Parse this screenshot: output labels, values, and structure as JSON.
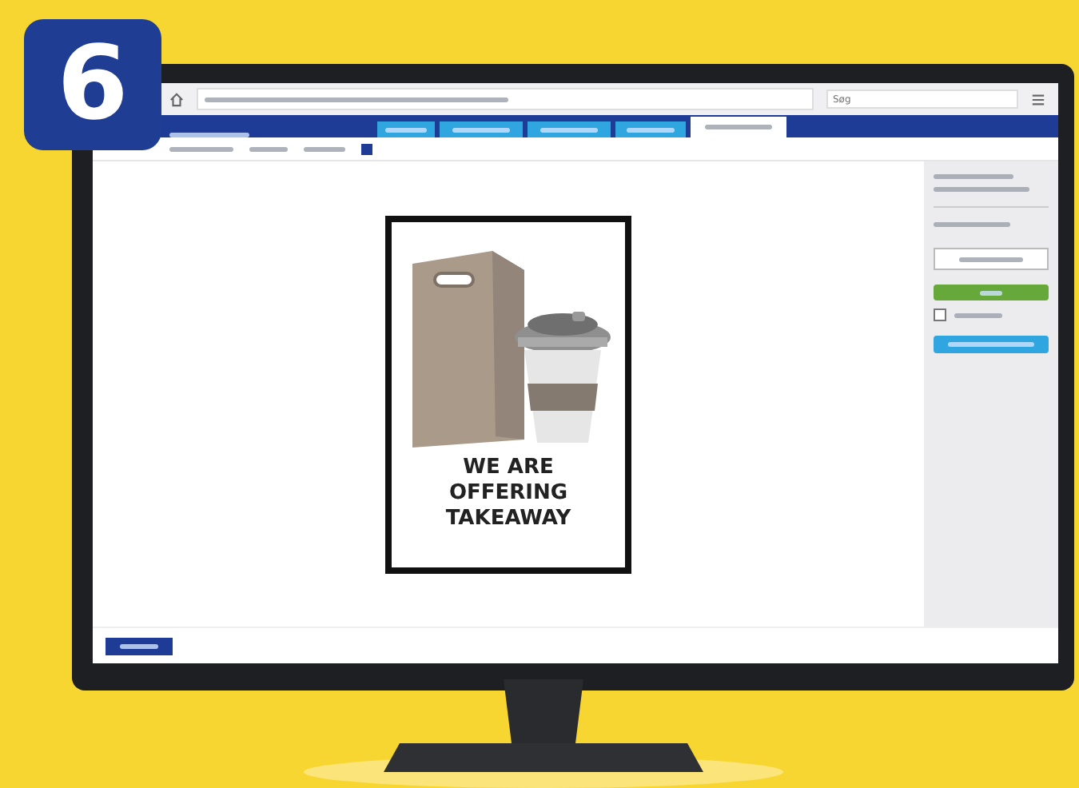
{
  "step_badge": "6",
  "browser": {
    "search": {
      "placeholder": "Søg"
    }
  },
  "nav": {
    "tabs": [
      {
        "selected": false
      },
      {
        "selected": false
      },
      {
        "selected": false
      },
      {
        "selected": false
      },
      {
        "selected": true
      }
    ]
  },
  "sign": {
    "headline": [
      "WE ARE",
      "OFFERING",
      "TAKEAWAY"
    ]
  },
  "panel": {
    "checkbox": {
      "checked": false
    }
  }
}
